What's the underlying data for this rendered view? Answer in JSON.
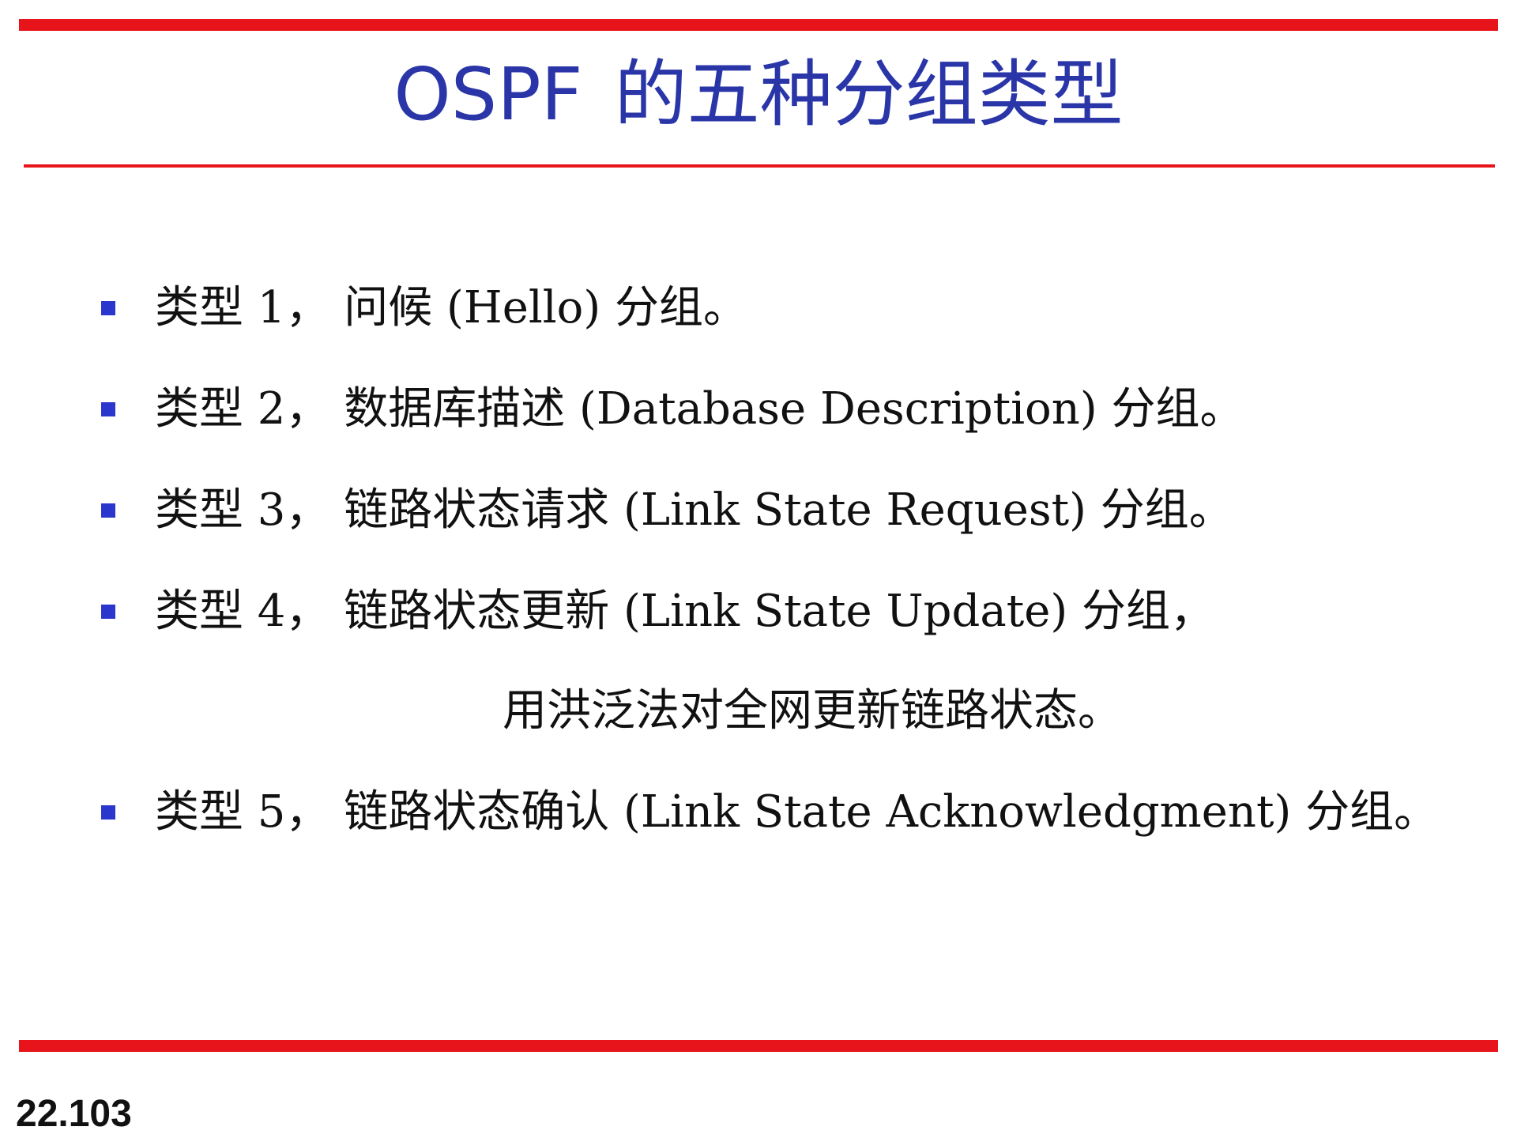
{
  "slide": {
    "title_latin": "OSPF",
    "title_cjk": "的五种分组类型",
    "items": [
      {
        "text": "类型 1， 问候 (Hello) 分组。"
      },
      {
        "text": "类型 2， 数据库描述 (Database Description) 分组。"
      },
      {
        "text": "类型 3， 链路状态请求 (Link State Request) 分组。"
      },
      {
        "text": "类型 4， 链路状态更新 (Link State Update) 分组，"
      },
      {
        "text": "类型 5， 链路状态确认 (Link State Acknowledgment) 分组。"
      }
    ],
    "item4_continuation": "用洪泛法对全网更新链路状态。",
    "slide_number": "22.103"
  },
  "colors": {
    "rule": "#e8141c",
    "title": "#2a36a8",
    "bullet": "#2a36cc",
    "text": "#111111"
  }
}
